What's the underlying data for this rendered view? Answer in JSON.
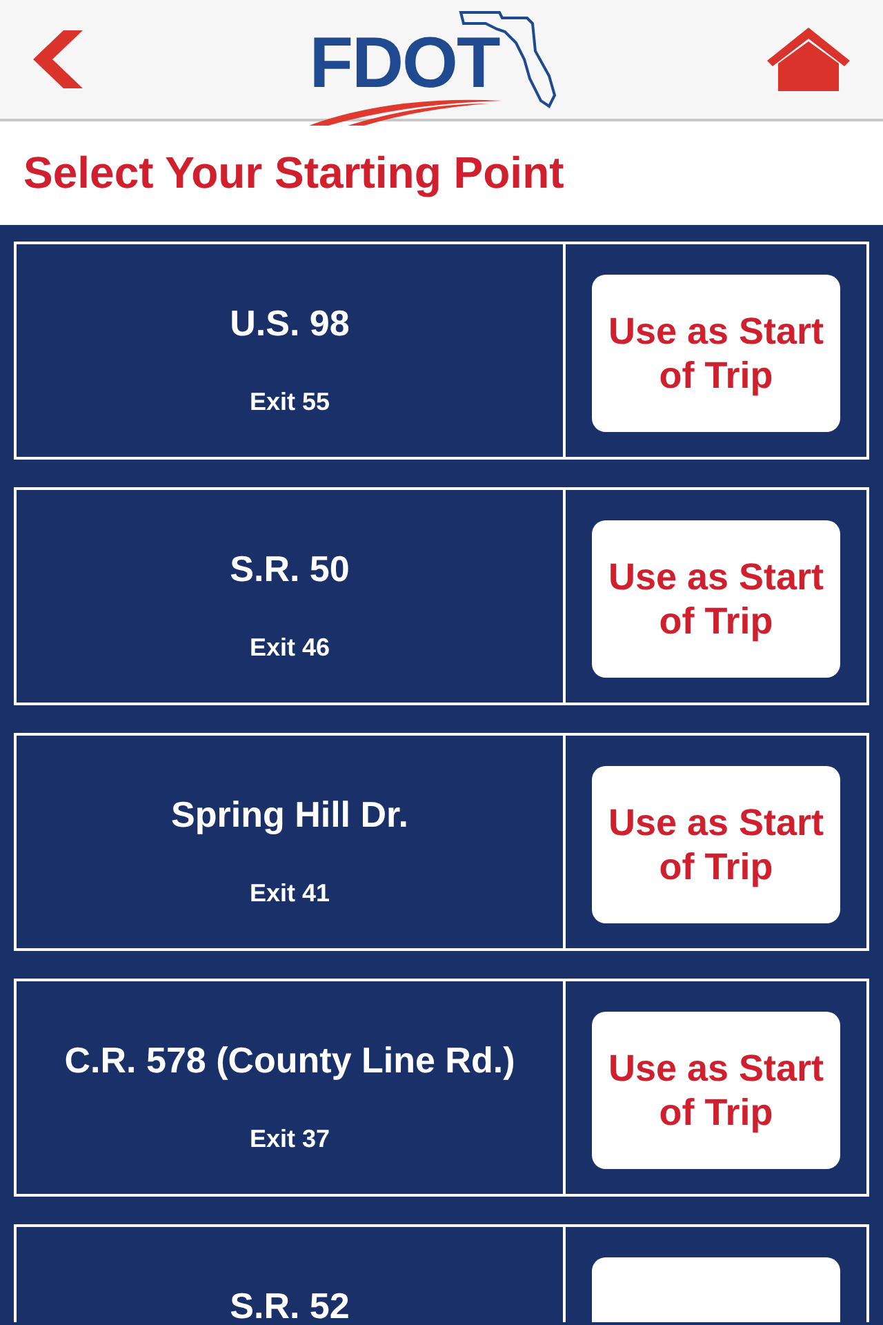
{
  "header": {
    "logo_text": "FDOT"
  },
  "title": "Select Your Starting Point",
  "exits": [
    {
      "name": "U.S. 98",
      "exit": "Exit 55",
      "button": "Use as Start of Trip"
    },
    {
      "name": "S.R. 50",
      "exit": "Exit 46",
      "button": "Use as Start of Trip"
    },
    {
      "name": "Spring Hill Dr.",
      "exit": "Exit 41",
      "button": "Use as Start of Trip"
    },
    {
      "name": "C.R. 578 (County Line Rd.)",
      "exit": "Exit 37",
      "button": "Use as Start of Trip"
    },
    {
      "name": "S.R. 52"
    }
  ]
}
